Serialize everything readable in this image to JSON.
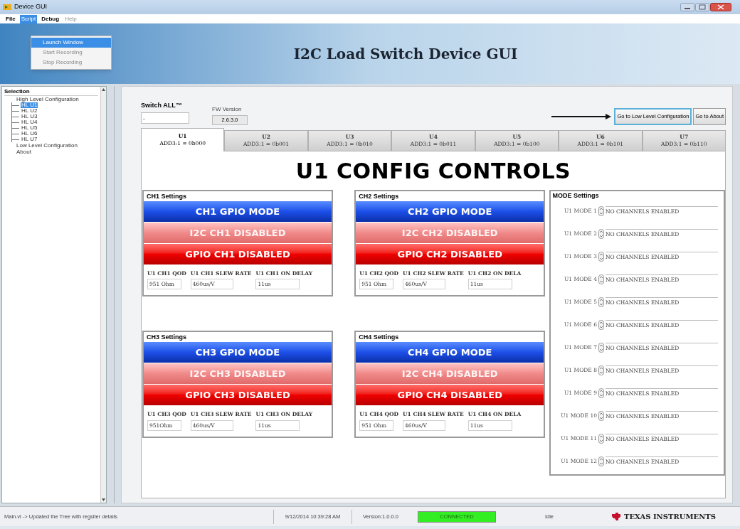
{
  "window": {
    "title": "Device GUI"
  },
  "menu": [
    {
      "label": "File",
      "selected": false,
      "disabled": false
    },
    {
      "label": "Script",
      "selected": true,
      "disabled": false
    },
    {
      "label": "Debug",
      "selected": false,
      "disabled": false
    },
    {
      "label": "Help",
      "selected": false,
      "disabled": true
    }
  ],
  "script_menu": [
    {
      "label": "Launch Window",
      "selected": true,
      "disabled": false
    },
    {
      "label": "Start Recording",
      "selected": false,
      "disabled": true
    },
    {
      "label": "Stop Recording",
      "selected": false,
      "disabled": true
    }
  ],
  "banner": {
    "title": "I2C Load Switch Device GUI"
  },
  "sidebar": {
    "header": "Selection",
    "tree": [
      {
        "label": "High Level Configuration",
        "selected": false,
        "children": [
          {
            "label": "HL U1",
            "selected": true
          },
          {
            "label": "HL U2",
            "selected": false
          },
          {
            "label": "HL U3",
            "selected": false
          },
          {
            "label": "HL U4",
            "selected": false
          },
          {
            "label": "HL U5",
            "selected": false
          },
          {
            "label": "HL U6",
            "selected": false
          },
          {
            "label": "HL U7",
            "selected": false
          }
        ]
      },
      {
        "label": "Low Level Configuration",
        "selected": false
      },
      {
        "label": "About",
        "selected": false
      }
    ]
  },
  "switch_all": {
    "label": "Switch ALL™",
    "value": "-"
  },
  "fw_version": {
    "label": "FW Version",
    "value": "2.6.3.0"
  },
  "buttons": [
    {
      "label": "Go to Low Level Configuration",
      "focused": true
    },
    {
      "label": "Go to About",
      "focused": false
    }
  ],
  "tabs": [
    {
      "label": "U1",
      "address": "ADD3:1 = 0b000",
      "selected": true
    },
    {
      "label": "U2",
      "address": "ADD3:1 = 0b001",
      "selected": false
    },
    {
      "label": "U3",
      "address": "ADD3:1 = 0b010",
      "selected": false
    },
    {
      "label": "U4",
      "address": "ADD3:1 = 0b011",
      "selected": false
    },
    {
      "label": "U5",
      "address": "ADD3:1 = 0b100",
      "selected": false
    },
    {
      "label": "U6",
      "address": "ADD3:1 = 0b101",
      "selected": false
    },
    {
      "label": "U7",
      "address": "ADD3:1 = 0b110",
      "selected": false
    }
  ],
  "heading": "U1 CONFIG CONTROLS",
  "channels": [
    {
      "title": "CH1 Settings",
      "bars": [
        {
          "kind": "mode",
          "label": "CH1 GPIO MODE"
        },
        {
          "kind": "i2c_disabled",
          "label": "I2C CH1 DISABLED"
        },
        {
          "kind": "gpio_disabled",
          "label": "GPIO CH1 DISABLED"
        }
      ],
      "fields": [
        {
          "label": "U1 CH1 QOD",
          "value": "951 Ohm"
        },
        {
          "label": "U1 CH1 SLEW RATE",
          "value": "460us/V"
        },
        {
          "label": "U1 CH1 ON DELAY",
          "value": "11us"
        }
      ]
    },
    {
      "title": "CH2 Settings",
      "bars": [
        {
          "kind": "mode",
          "label": "CH2 GPIO MODE"
        },
        {
          "kind": "i2c_disabled",
          "label": "I2C CH2 DISABLED"
        },
        {
          "kind": "gpio_disabled",
          "label": "GPIO CH2 DISABLED"
        }
      ],
      "fields": [
        {
          "label": "U1 CH2 QOD",
          "value": "951 Ohm"
        },
        {
          "label": "U1 CH2 SLEW RATE",
          "value": "460us/V"
        },
        {
          "label": "U1 CH2 ON DELA",
          "value": "11us"
        }
      ]
    },
    {
      "title": "CH3 Settings",
      "bars": [
        {
          "kind": "mode",
          "label": "CH3 GPIO MODE"
        },
        {
          "kind": "i2c_disabled",
          "label": "I2C CH3 DISABLED"
        },
        {
          "kind": "gpio_disabled",
          "label": "GPIO CH3 DISABLED"
        }
      ],
      "fields": [
        {
          "label": "U1 CH3 QOD",
          "value": "951Ohm"
        },
        {
          "label": "U1 CH3 SLEW RATE",
          "value": "460us/V"
        },
        {
          "label": "U1 CH3 ON DELAY",
          "value": "11us"
        }
      ]
    },
    {
      "title": "CH4 Settings",
      "bars": [
        {
          "kind": "mode",
          "label": "CH4 GPIO MODE"
        },
        {
          "kind": "i2c_disabled",
          "label": "I2C CH4 DISABLED"
        },
        {
          "kind": "gpio_disabled",
          "label": "GPIO CH4 DISABLED"
        }
      ],
      "fields": [
        {
          "label": "U1 CH4 QOD",
          "value": "951 Ohm"
        },
        {
          "label": "U1 CH4 SLEW RATE",
          "value": "460us/V"
        },
        {
          "label": "U1 CH4 ON DELA",
          "value": "11us"
        }
      ]
    }
  ],
  "mode_settings": {
    "title": "MODE Settings",
    "rows": [
      {
        "label": "U1 MODE 1",
        "value": "NO CHANNELS ENABLED"
      },
      {
        "label": "U1 MODE 2",
        "value": "NO CHANNELS ENABLED"
      },
      {
        "label": "U1 MODE 3",
        "value": "NO CHANNELS ENABLED"
      },
      {
        "label": "U1 MODE 4",
        "value": "NO CHANNELS ENABLED"
      },
      {
        "label": "U1 MODE 5",
        "value": "NO CHANNELS ENABLED"
      },
      {
        "label": "U1 MODE 6",
        "value": "NO CHANNELS ENABLED"
      },
      {
        "label": "U1 MODE 7",
        "value": "NO CHANNELS ENABLED"
      },
      {
        "label": "U1 MODE 8",
        "value": "NO CHANNELS ENABLED"
      },
      {
        "label": "U1 MODE 9",
        "value": "NO CHANNELS ENABLED"
      },
      {
        "label": "U1 MODE 10",
        "value": "NO CHANNELS ENABLED"
      },
      {
        "label": "U1 MODE 11",
        "value": "NO CHANNELS ENABLED"
      },
      {
        "label": "U1 MODE 12",
        "value": "NO CHANNELS ENABLED"
      }
    ]
  },
  "status_bar": {
    "message": "Main.vi -> Updated the Tree with regsiter details",
    "timestamp": "9/12/2014 10:39:28 AM",
    "version": "Version:1.0.0.0",
    "connection": {
      "text": "CONNECTED",
      "on": true
    },
    "state": "Idle",
    "brand": "TEXAS INSTRUMENTS"
  }
}
